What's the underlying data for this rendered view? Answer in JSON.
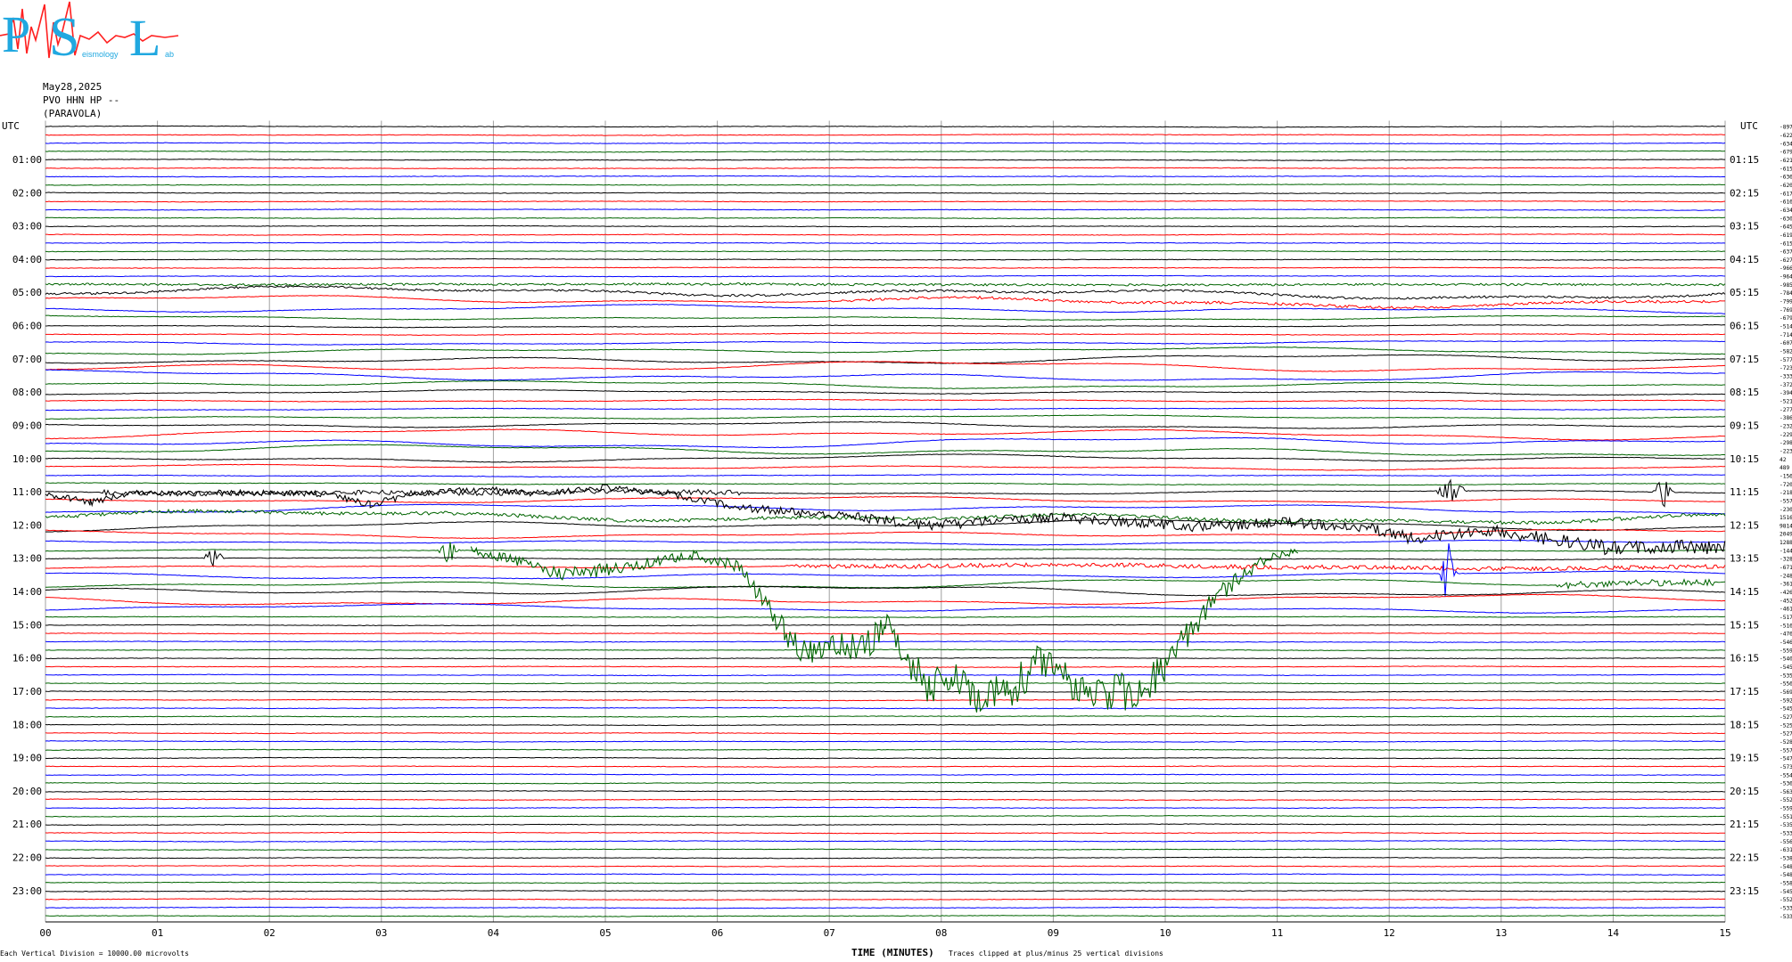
{
  "logo": {
    "letters": [
      "P",
      "S",
      "L"
    ],
    "small_text": "eismology",
    "small_text_2": "ab"
  },
  "header": {
    "date": "May28,2025",
    "station": "PVO HHN HP --",
    "site": "(PARAVOLA)"
  },
  "colors": {
    "cycle": [
      "#000000",
      "#ff0000",
      "#0000ff",
      "#006400"
    ],
    "grid": "#a0a0a0",
    "background": "#ffffff"
  },
  "chart_data": {
    "type": "line",
    "title": "",
    "xlabel": "TIME (MINUTES)",
    "ylabel": "",
    "xlim": [
      0,
      15
    ],
    "x_ticks": [
      "00",
      "01",
      "02",
      "03",
      "04",
      "05",
      "06",
      "07",
      "08",
      "09",
      "10",
      "11",
      "12",
      "13",
      "14",
      "15"
    ],
    "left_axis_title": "UTC",
    "right_axis_title": "UTC",
    "left_hour_labels": [
      "01:00",
      "02:00",
      "03:00",
      "04:00",
      "05:00",
      "06:00",
      "07:00",
      "08:00",
      "09:00",
      "10:00",
      "11:00",
      "12:00",
      "13:00",
      "14:00",
      "15:00",
      "16:00",
      "17:00",
      "18:00",
      "19:00",
      "20:00",
      "21:00",
      "22:00",
      "23:00"
    ],
    "right_hour_labels": [
      "01:15",
      "02:15",
      "03:15",
      "04:15",
      "05:15",
      "06:15",
      "07:15",
      "08:15",
      "09:15",
      "10:15",
      "11:15",
      "12:15",
      "13:15",
      "14:15",
      "15:15",
      "16:15",
      "17:15",
      "18:15",
      "19:15",
      "20:15",
      "21:15",
      "22:15",
      "23:15"
    ],
    "trace_count": 96,
    "trace_minutes": 15,
    "trace_offsets": [
      "-8974",
      "-6223",
      "-6347",
      "-6796",
      "-6219",
      "-6150",
      "-6367",
      "-6204",
      "-6177",
      "-6165",
      "-6349",
      "-6306",
      "-6457",
      "-6193",
      "-6158",
      "-6370",
      "-6276",
      "-9669",
      "-9643",
      "-9856",
      "-7848",
      "-7997",
      "-7691",
      "-6791",
      "-5144",
      "-7147",
      "-6074",
      "-5823",
      "-5778",
      "-7230",
      "-3339",
      "-3724",
      "-3940",
      "-5218",
      "-2771",
      "-386",
      "-2328",
      "-2293",
      "-2989",
      "-2237",
      "42",
      "489",
      "-1564",
      "-720",
      "-2186",
      "-5578",
      "-230",
      "15163",
      "9814",
      "2049",
      "1288",
      "-1445",
      "-328",
      "-671",
      "-2488",
      "-3610",
      "-4264",
      "-4528",
      "-4616",
      "-5179",
      "-5161",
      "-4765",
      "-5462",
      "-5597",
      "-5403",
      "-5451",
      "-5354",
      "-5563",
      "-5694",
      "-5921",
      "-5458",
      "-5279",
      "-5256",
      "-5272",
      "-5288",
      "-5579",
      "-5475",
      "-5731",
      "-5549",
      "-5364",
      "-5634",
      "-5524",
      "-5597",
      "-5514",
      "-5355",
      "-5336",
      "-5561",
      "-6315",
      "-5381",
      "-5486",
      "-5489",
      "-5586",
      "-5453",
      "-5525",
      "-5339",
      "-5339"
    ],
    "events": [
      {
        "trace": 19,
        "minute_start": 0.0,
        "minute_end": 15.0,
        "amplitude": 0.25,
        "style": "noise"
      },
      {
        "trace": 20,
        "minute_start": 0.0,
        "minute_end": 15.0,
        "amplitude": 0.25,
        "style": "noise"
      },
      {
        "trace": 21,
        "minute_start": 7.0,
        "minute_end": 15.0,
        "amplitude": 0.3,
        "style": "noise"
      },
      {
        "trace": 44,
        "minute_start": 0.5,
        "minute_end": 6.2,
        "amplitude": 0.6,
        "style": "burst"
      },
      {
        "trace": 44,
        "minute_start": 12.4,
        "minute_end": 12.7,
        "amplitude": 1.6,
        "style": "spike"
      },
      {
        "trace": 44,
        "minute_start": 14.35,
        "minute_end": 14.55,
        "amplitude": 2.2,
        "style": "spike"
      },
      {
        "trace": 47,
        "minute_start": 0.0,
        "minute_end": 15.0,
        "amplitude": 0.4,
        "style": "noise"
      },
      {
        "trace": 51,
        "minute_start": 3.5,
        "minute_end": 3.7,
        "amplitude": 1.8,
        "style": "spike"
      },
      {
        "trace": 52,
        "minute_start": 1.4,
        "minute_end": 1.6,
        "amplitude": 1.4,
        "style": "spike"
      },
      {
        "trace": 53,
        "minute_start": 6.6,
        "minute_end": 15.0,
        "amplitude": 0.5,
        "style": "burst"
      },
      {
        "trace": 54,
        "minute_start": 12.45,
        "minute_end": 12.6,
        "amplitude": 5.0,
        "style": "spike"
      },
      {
        "trace": 55,
        "minute_start": 13.5,
        "minute_end": 14.9,
        "amplitude": 0.8,
        "style": "burst"
      }
    ],
    "green_excursion": {
      "trace": 51,
      "points": [
        [
          3.8,
          0
        ],
        [
          4.3,
          1.5
        ],
        [
          4.6,
          3.0
        ],
        [
          5.2,
          2.0
        ],
        [
          5.8,
          0.5
        ],
        [
          6.2,
          2.0
        ],
        [
          6.4,
          6.0
        ],
        [
          6.6,
          9.5
        ],
        [
          6.8,
          13.0
        ],
        [
          7.0,
          11.5
        ],
        [
          7.3,
          12.0
        ],
        [
          7.5,
          9.0
        ],
        [
          7.7,
          13.0
        ],
        [
          7.9,
          17.0
        ],
        [
          8.1,
          15.0
        ],
        [
          8.3,
          17.0
        ],
        [
          8.6,
          17.0
        ],
        [
          8.9,
          13.0
        ],
        [
          9.2,
          16.0
        ],
        [
          9.5,
          17.0
        ],
        [
          9.8,
          17.0
        ],
        [
          10.0,
          14.0
        ],
        [
          10.2,
          10.0
        ],
        [
          10.5,
          5.0
        ],
        [
          10.9,
          1.0
        ],
        [
          11.2,
          0.0
        ]
      ]
    },
    "black_wander": {
      "trace": 44,
      "points": [
        [
          0.0,
          0.3
        ],
        [
          0.4,
          1.2
        ],
        [
          0.8,
          0.0
        ],
        [
          1.5,
          0.0
        ],
        [
          2.5,
          0.2
        ],
        [
          2.9,
          1.5
        ],
        [
          3.3,
          0.2
        ],
        [
          3.9,
          -0.4
        ],
        [
          4.4,
          0.2
        ],
        [
          5.0,
          -0.6
        ],
        [
          5.6,
          0.3
        ],
        [
          6.2,
          1.8
        ],
        [
          6.8,
          2.5
        ],
        [
          7.4,
          3.2
        ],
        [
          7.9,
          4.0
        ],
        [
          8.4,
          3.5
        ],
        [
          9.0,
          3.0
        ],
        [
          9.7,
          3.6
        ],
        [
          10.4,
          4.2
        ],
        [
          11.0,
          3.6
        ],
        [
          11.8,
          4.3
        ],
        [
          12.2,
          5.5
        ],
        [
          12.9,
          4.6
        ],
        [
          13.4,
          5.6
        ],
        [
          14.0,
          6.8
        ],
        [
          14.6,
          6.6
        ],
        [
          15.0,
          6.6
        ]
      ]
    }
  },
  "footer": {
    "scale_note": "Each Vertical Division = 10000.00 microvolts",
    "clip_note": "Traces clipped at plus/minus 25 vertical divisions"
  }
}
